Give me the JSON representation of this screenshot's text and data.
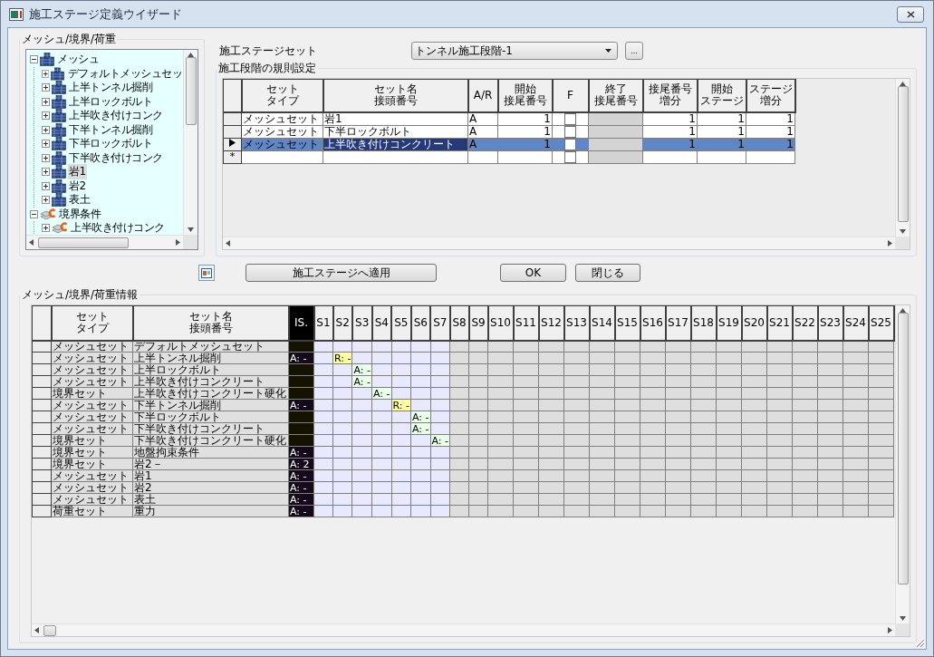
{
  "window": {
    "title": "施工ステージ定義ウイザード"
  },
  "tree_group": {
    "title": "メッシュ/境界/荷重",
    "items": [
      {
        "label": "メッシュ",
        "kind": "mesh",
        "expanded": true,
        "selected": false,
        "children": [
          {
            "label": "デフォルトメッシュセッ",
            "kind": "mesh",
            "expanded": false,
            "selected": false
          },
          {
            "label": "上半トンネル掘削",
            "kind": "mesh",
            "expanded": false,
            "selected": false
          },
          {
            "label": "上半ロックボルト",
            "kind": "mesh",
            "expanded": false,
            "selected": false
          },
          {
            "label": "上半吹き付けコンク",
            "kind": "mesh",
            "expanded": false,
            "selected": false
          },
          {
            "label": "下半トンネル掘削",
            "kind": "mesh",
            "expanded": false,
            "selected": false
          },
          {
            "label": "下半ロックボルト",
            "kind": "mesh",
            "expanded": false,
            "selected": false
          },
          {
            "label": "下半吹き付けコンク",
            "kind": "mesh",
            "expanded": false,
            "selected": false
          },
          {
            "label": "岩1",
            "kind": "mesh",
            "expanded": false,
            "selected": true
          },
          {
            "label": "岩2",
            "kind": "mesh",
            "expanded": false,
            "selected": false
          },
          {
            "label": "表土",
            "kind": "mesh",
            "expanded": false,
            "selected": false
          }
        ]
      },
      {
        "label": "境界条件",
        "kind": "boundary",
        "expanded": true,
        "selected": false,
        "children": [
          {
            "label": "上半吹き付けコンク",
            "kind": "boundary",
            "expanded": false,
            "selected": false
          }
        ]
      }
    ]
  },
  "stage_set": {
    "label": "施工ステージセット",
    "value": "トンネル施工段階-1",
    "more_button": "..."
  },
  "rules": {
    "title": "施工段階の規則設定",
    "columns": [
      [
        "セット",
        "タイプ"
      ],
      [
        "セット名",
        "接頭番号"
      ],
      [
        "A/R"
      ],
      [
        "開始",
        "接尾番号"
      ],
      [
        "F"
      ],
      [
        "終了",
        "接尾番号"
      ],
      [
        "接尾番号",
        "増分"
      ],
      [
        "開始",
        "ステージ"
      ],
      [
        "ステージ",
        "増分"
      ]
    ],
    "rows": [
      {
        "type": "メッシュセット",
        "name": "岩1",
        "ar": "A",
        "start": "1",
        "f_checked": false,
        "inc": "1",
        "start_stage": "1",
        "stage_inc": "1",
        "selected": false
      },
      {
        "type": "メッシュセット",
        "name": "下半ロックボルト",
        "ar": "A",
        "start": "1",
        "f_checked": false,
        "inc": "1",
        "start_stage": "1",
        "stage_inc": "1",
        "selected": false
      },
      {
        "type": "メッシュセット",
        "name": "上半吹き付けコンクリート",
        "ar": "A",
        "start": "1",
        "f_checked": false,
        "inc": "1",
        "start_stage": "1",
        "stage_inc": "1",
        "selected": true
      }
    ],
    "new_row": {
      "marker": "*",
      "f_checked": false
    }
  },
  "buttons": {
    "apply": "施工ステージへ適用",
    "ok": "OK",
    "close": "閉じる"
  },
  "info": {
    "title": "メッシュ/境界/荷重情報",
    "columns": [
      [
        "セット",
        "タイプ"
      ],
      [
        "セット名",
        "接頭番号"
      ],
      [
        "IS."
      ]
    ],
    "stages": [
      {
        "label": "S1",
        "active": true
      },
      {
        "label": "S2",
        "active": true
      },
      {
        "label": "S3",
        "active": true
      },
      {
        "label": "S4",
        "active": true
      },
      {
        "label": "S5",
        "active": true
      },
      {
        "label": "S6",
        "active": true
      },
      {
        "label": "S7",
        "active": true
      },
      {
        "label": "S8",
        "active": false
      },
      {
        "label": "S9",
        "active": false
      },
      {
        "label": "S10",
        "active": false
      },
      {
        "label": "S11",
        "active": false
      },
      {
        "label": "S12",
        "active": false
      },
      {
        "label": "S13",
        "active": false
      },
      {
        "label": "S14",
        "active": false
      },
      {
        "label": "S15",
        "active": false
      },
      {
        "label": "S16",
        "active": false
      },
      {
        "label": "S17",
        "active": false
      },
      {
        "label": "S18",
        "active": false
      },
      {
        "label": "S19",
        "active": false
      },
      {
        "label": "S20",
        "active": false
      },
      {
        "label": "S21",
        "active": false
      },
      {
        "label": "S22",
        "active": false
      },
      {
        "label": "S23",
        "active": false
      },
      {
        "label": "S24",
        "active": false
      },
      {
        "label": "S25",
        "active": false
      }
    ],
    "rows": [
      {
        "type": "メッシュセット",
        "name": "デフォルトメッシュセット"
      },
      {
        "type": "メッシュセット",
        "name": "上半トンネル掘削",
        "is": "A: -",
        "cells": [
          null,
          {
            "text": "R: -",
            "kind": "remove"
          }
        ]
      },
      {
        "type": "メッシュセット",
        "name": "上半ロックボルト",
        "cells": [
          null,
          null,
          {
            "text": "A: -",
            "kind": "add"
          }
        ]
      },
      {
        "type": "メッシュセット",
        "name": "上半吹き付けコンクリート",
        "cells": [
          null,
          null,
          {
            "text": "A: -",
            "kind": "add"
          }
        ]
      },
      {
        "type": "境界セット",
        "name": "上半吹き付けコンクリート硬化",
        "cells": [
          null,
          null,
          null,
          {
            "text": "A: -",
            "kind": "add"
          }
        ]
      },
      {
        "type": "メッシュセット",
        "name": "下半トンネル掘削",
        "is": "A: -",
        "cells": [
          null,
          null,
          null,
          null,
          {
            "text": "R: -",
            "kind": "remove"
          }
        ]
      },
      {
        "type": "メッシュセット",
        "name": "下半ロックボルト",
        "cells": [
          null,
          null,
          null,
          null,
          null,
          {
            "text": "A: -",
            "kind": "add"
          }
        ]
      },
      {
        "type": "メッシュセット",
        "name": "下半吹き付けコンクリート",
        "cells": [
          null,
          null,
          null,
          null,
          null,
          {
            "text": "A: -",
            "kind": "add"
          }
        ]
      },
      {
        "type": "境界セット",
        "name": "下半吹き付けコンクリート硬化",
        "cells": [
          null,
          null,
          null,
          null,
          null,
          null,
          {
            "text": "A: -",
            "kind": "add"
          }
        ]
      },
      {
        "type": "境界セット",
        "name": "地盤拘束条件",
        "is": "A: -"
      },
      {
        "type": "境界セット",
        "name": "岩2－",
        "is": "A: 2"
      },
      {
        "type": "メッシュセット",
        "name": "岩1",
        "is": "A: -"
      },
      {
        "type": "メッシュセット",
        "name": "岩2",
        "is": "A: -"
      },
      {
        "type": "メッシュセット",
        "name": "表土",
        "is": "A: -"
      },
      {
        "type": "荷重セット",
        "name": "重力",
        "is": "A: -"
      }
    ]
  }
}
